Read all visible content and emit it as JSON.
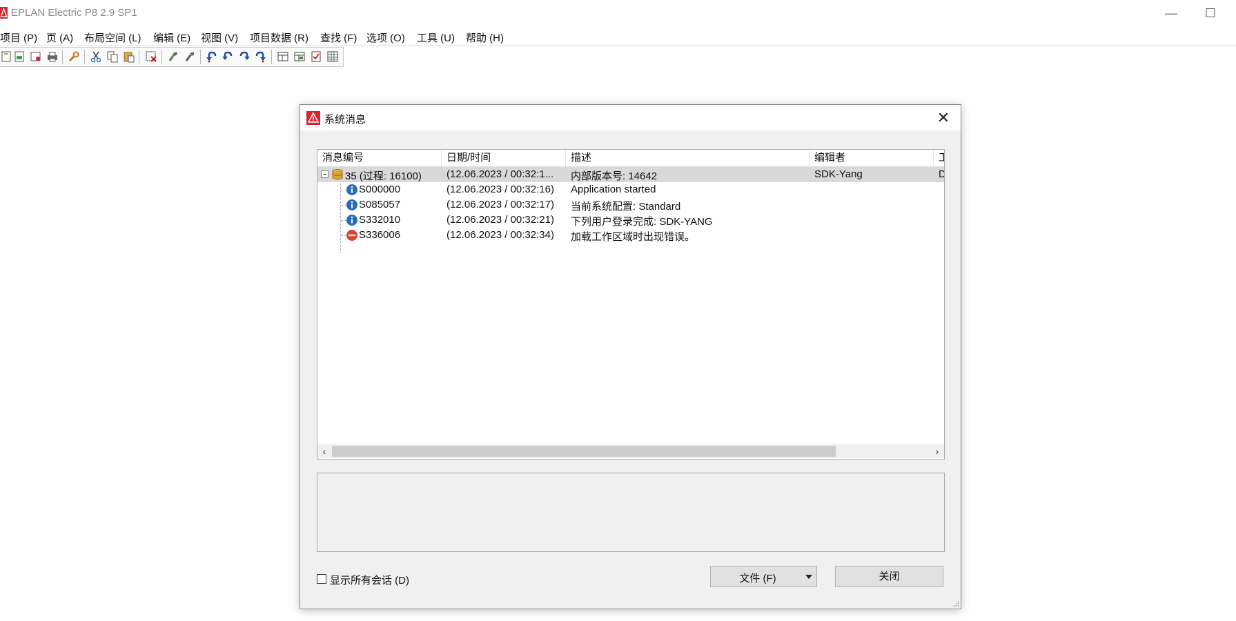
{
  "app": {
    "title": "EPLAN Electric P8 2.9 SP1",
    "minimize_glyph": "—",
    "maximize_glyph": "☐",
    "brand_color": "#d9232d"
  },
  "menu": [
    {
      "label": "项目 (P)"
    },
    {
      "label": "页 (A)"
    },
    {
      "label": "布局空间 (L)"
    },
    {
      "label": "编辑 (E)"
    },
    {
      "label": "视图 (V)"
    },
    {
      "label": "项目数据 (R)"
    },
    {
      "label": "查找 (F)"
    },
    {
      "label": "选项 (O)"
    },
    {
      "label": "工具 (U)"
    },
    {
      "label": "帮助 (H)"
    }
  ],
  "toolbar": {
    "icons": [
      "new-page-icon",
      "open-page-icon",
      "page-properties-icon",
      "print-icon",
      "settings-wrench-icon",
      "cut-icon",
      "copy-icon",
      "paste-icon",
      "delete-selection-icon",
      "brush-icon",
      "format-brush-icon",
      "undo-icon",
      "undo-list-icon",
      "redo-icon",
      "redo-list-icon",
      "layout-icon",
      "layout-edit-icon",
      "checklist-icon",
      "table-icon"
    ]
  },
  "dialog": {
    "title": "系统消息",
    "close_glyph": "✕",
    "columns": [
      "消息编号",
      "日期/时间",
      "描述",
      "编辑者",
      "工"
    ],
    "group_row": {
      "id": "35 (过程: 16100)",
      "datetime": "(12.06.2023 / 00:32:1...",
      "description": "内部版本号: 14642",
      "editor": "SDK-Yang",
      "extra": "D"
    },
    "messages": [
      {
        "id": "S000000",
        "datetime": "(12.06.2023 / 00:32:16)",
        "description": "Application started",
        "type": "info-icon"
      },
      {
        "id": "S085057",
        "datetime": "(12.06.2023 / 00:32:17)",
        "description": "当前系统配置: Standard",
        "type": "info-icon"
      },
      {
        "id": "S332010",
        "datetime": "(12.06.2023 / 00:32:21)",
        "description": "下列用户登录完成: SDK-YANG",
        "type": "info-icon"
      },
      {
        "id": "S336006",
        "datetime": "(12.06.2023 / 00:32:34)",
        "description": "加载工作区域时出现错误。",
        "type": "error-icon"
      }
    ],
    "scroll_left_glyph": "‹",
    "scroll_right_glyph": "›",
    "show_all_sessions_label": "显示所有会话 (D)",
    "show_all_sessions_checked": false,
    "file_button_label": "文件 (F)",
    "close_button_label": "关闭",
    "info_color": "#2a6db5",
    "error_color": "#d9432f"
  }
}
